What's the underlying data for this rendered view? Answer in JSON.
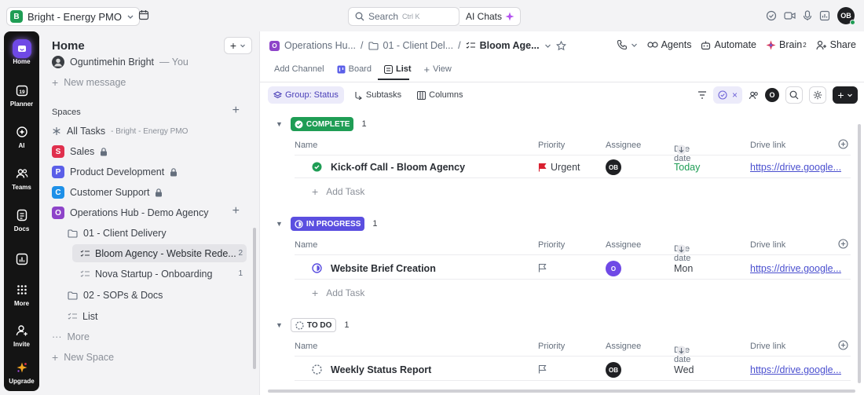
{
  "topbar": {
    "workspace_badge": "B",
    "workspace_name": "Bright - Energy PMO",
    "search_label": "Search",
    "search_shortcut": "Ctrl K",
    "ai_chats_label": "AI Chats",
    "avatar_initials": "OB"
  },
  "rail": {
    "items": [
      {
        "label": "Home"
      },
      {
        "label": "Planner",
        "badge": "19"
      },
      {
        "label": "AI"
      },
      {
        "label": "Teams"
      },
      {
        "label": "Docs"
      },
      {
        "label": ""
      },
      {
        "label": "More"
      },
      {
        "label": "Invite"
      },
      {
        "label": "Upgrade"
      }
    ]
  },
  "sidebar": {
    "title": "Home",
    "user_name": "Oguntimehin Bright",
    "user_suffix": "— You",
    "new_message": "New message",
    "spaces_label": "Spaces",
    "all_tasks": "All Tasks",
    "all_tasks_sub": "- Bright - Energy PMO",
    "spaces": [
      {
        "badge": "S",
        "name": "Sales",
        "color": "#e0304e"
      },
      {
        "badge": "P",
        "name": "Product Development",
        "color": "#5b5fe8"
      },
      {
        "badge": "C",
        "name": "Customer Support",
        "color": "#1e90e8"
      },
      {
        "badge": "O",
        "name": "Operations Hub - Demo Agency",
        "color": "#8e44c9"
      }
    ],
    "folder_client": "01 - Client Delivery",
    "list_bloom": "Bloom Agency - Website Rede...",
    "list_bloom_count": "2",
    "list_nova": "Nova Startup - Onboarding",
    "list_nova_count": "1",
    "folder_sops": "02 - SOPs & Docs",
    "list_plain": "List",
    "more": "More",
    "new_space": "New Space"
  },
  "header": {
    "crumb_space": "Operations Hu...",
    "crumb_folder": "01 - Client Del...",
    "crumb_list": "Bloom Age...",
    "agents": "Agents",
    "automate": "Automate",
    "brain": "Brain",
    "brain_sup": "2",
    "share": "Share"
  },
  "views": {
    "add_channel": "Add Channel",
    "board": "Board",
    "list": "List",
    "add_view": "View"
  },
  "toolbar": {
    "group": "Group: Status",
    "subtasks": "Subtasks",
    "columns": "Columns",
    "avatar_letter": "O"
  },
  "columns": {
    "name": "Name",
    "priority": "Priority",
    "assignee": "Assignee",
    "due_date": "Due date",
    "drive_link": "Drive link"
  },
  "groups": [
    {
      "status": "COMPLETE",
      "count": "1",
      "color": "#1f9d55",
      "add_task": "Add Task",
      "task": {
        "name": "Kick-off Call - Bloom Agency",
        "priority": "Urgent",
        "assignee": "OB",
        "due": "Today",
        "link": "https://drive.google..."
      }
    },
    {
      "status": "IN PROGRESS",
      "count": "1",
      "color": "#5b4fe0",
      "add_task": "Add Task",
      "task": {
        "name": "Website Brief Creation",
        "priority": "",
        "assignee": "O",
        "due": "Mon",
        "link": "https://drive.google..."
      }
    },
    {
      "status": "TO DO",
      "count": "1",
      "color": "#ffffff",
      "task": {
        "name": "Weekly Status Report",
        "priority": "",
        "assignee": "OB",
        "due": "Wed",
        "link": "https://drive.google..."
      }
    }
  ]
}
